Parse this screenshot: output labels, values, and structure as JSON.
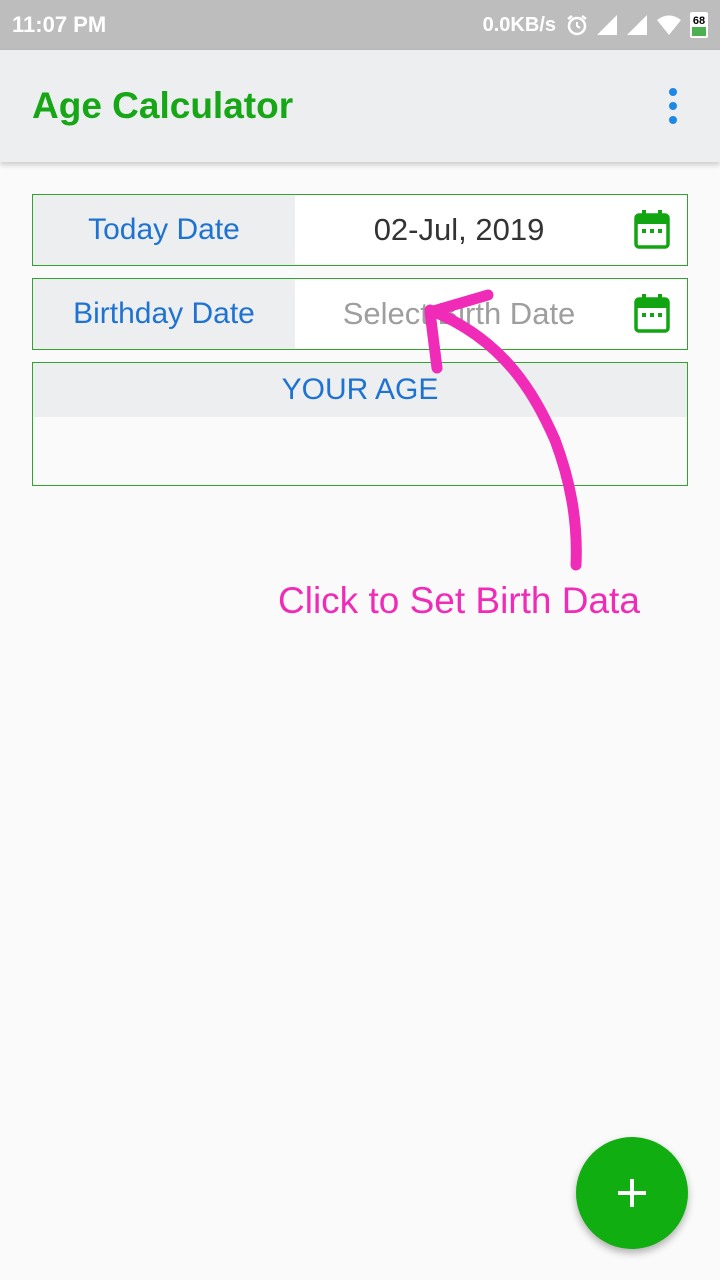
{
  "status_bar": {
    "time": "11:07 PM",
    "net_speed": "0.0KB/s",
    "battery_level": "68",
    "icons": [
      "alarm-icon",
      "signal-icon",
      "signal-icon",
      "wifi-icon",
      "battery-icon"
    ]
  },
  "app_bar": {
    "title": "Age Calculator",
    "menu_icon": "overflow-menu-icon"
  },
  "today": {
    "label": "Today Date",
    "value": "02-Jul, 2019",
    "icon": "calendar-icon"
  },
  "birthday": {
    "label": "Birthday Date",
    "placeholder": "Select Birth Date",
    "icon": "calendar-icon"
  },
  "age": {
    "header": "YOUR AGE",
    "value": ""
  },
  "annotation": {
    "text": "Click to Set Birth Data",
    "color": "#f02bb8"
  },
  "fab": {
    "icon": "plus-icon"
  },
  "colors": {
    "accent_green": "#16a616",
    "label_blue": "#1e73d2",
    "fab_green": "#10ae10"
  }
}
